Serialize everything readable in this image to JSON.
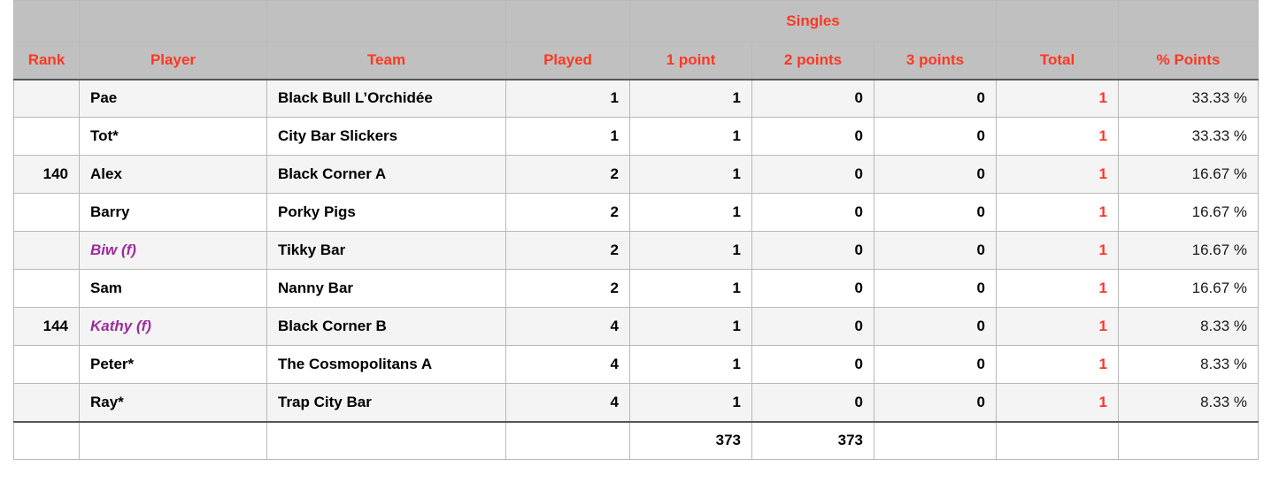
{
  "table": {
    "group_header": {
      "singles_label": "Singles",
      "singles_span": 3
    },
    "columns": [
      {
        "key": "rank",
        "label": "Rank"
      },
      {
        "key": "player",
        "label": "Player"
      },
      {
        "key": "team",
        "label": "Team"
      },
      {
        "key": "played",
        "label": "Played"
      },
      {
        "key": "p1",
        "label": "1 point"
      },
      {
        "key": "p2",
        "label": "2 points"
      },
      {
        "key": "p3",
        "label": "3 points"
      },
      {
        "key": "total",
        "label": "Total"
      },
      {
        "key": "pct",
        "label": "% Points"
      }
    ],
    "rows": [
      {
        "rank": "",
        "player": "Pae",
        "team": "Black Bull L’Orchidée",
        "played": "1",
        "p1": "1",
        "p2": "0",
        "p3": "0",
        "total": "1",
        "pct": "33.33 %",
        "female": false
      },
      {
        "rank": "",
        "player": "Tot*",
        "team": "City Bar Slickers",
        "played": "1",
        "p1": "1",
        "p2": "0",
        "p3": "0",
        "total": "1",
        "pct": "33.33 %",
        "female": false
      },
      {
        "rank": "140",
        "player": "Alex",
        "team": "Black Corner A",
        "played": "2",
        "p1": "1",
        "p2": "0",
        "p3": "0",
        "total": "1",
        "pct": "16.67 %",
        "female": false
      },
      {
        "rank": "",
        "player": "Barry",
        "team": "Porky Pigs",
        "played": "2",
        "p1": "1",
        "p2": "0",
        "p3": "0",
        "total": "1",
        "pct": "16.67 %",
        "female": false
      },
      {
        "rank": "",
        "player": "Biw (f)",
        "team": "Tikky Bar",
        "played": "2",
        "p1": "1",
        "p2": "0",
        "p3": "0",
        "total": "1",
        "pct": "16.67 %",
        "female": true
      },
      {
        "rank": "",
        "player": "Sam",
        "team": "Nanny Bar",
        "played": "2",
        "p1": "1",
        "p2": "0",
        "p3": "0",
        "total": "1",
        "pct": "16.67 %",
        "female": false
      },
      {
        "rank": "144",
        "player": "Kathy (f)",
        "team": "Black Corner B",
        "played": "4",
        "p1": "1",
        "p2": "0",
        "p3": "0",
        "total": "1",
        "pct": "8.33 %",
        "female": true
      },
      {
        "rank": "",
        "player": "Peter*",
        "team": "The Cosmopolitans A",
        "played": "4",
        "p1": "1",
        "p2": "0",
        "p3": "0",
        "total": "1",
        "pct": "8.33 %",
        "female": false
      },
      {
        "rank": "",
        "player": "Ray*",
        "team": "Trap City Bar",
        "played": "4",
        "p1": "1",
        "p2": "0",
        "p3": "0",
        "total": "1",
        "pct": "8.33 %",
        "female": false
      }
    ],
    "footer": {
      "rank": "",
      "player": "",
      "team": "",
      "played": "",
      "p1": "373",
      "p2": "373",
      "p3": "",
      "total": "",
      "pct": ""
    }
  },
  "colors": {
    "header_background": "#c0c0c0",
    "header_text": "#ff3823",
    "total_text": "#ff3823",
    "female_text": "#9c2a9c",
    "row_alt_background": "#f4f4f4",
    "row_background": "#ffffff",
    "grid_line": "#b9b9b9",
    "section_rule": "#555555"
  }
}
